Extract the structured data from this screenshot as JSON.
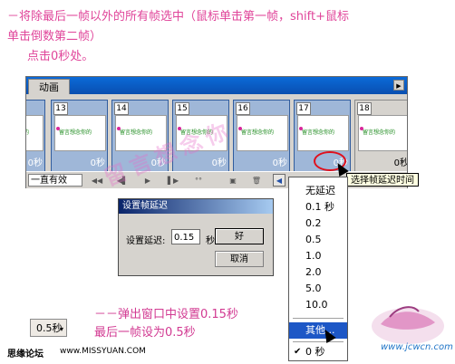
{
  "instructions": {
    "line1": "－将除最后一帧以外的所有帧选中（鼠标单击第一帧，shift+鼠标",
    "line2": "单击倒数第二帧）",
    "line3": "点击0秒处。",
    "bottom1": "－－弹出窗口中设置0.15秒",
    "bottom2": "最后一帧设为0.5秒"
  },
  "animation_panel": {
    "tab_label": "动画",
    "menu_button": "▶",
    "frames": [
      {
        "number": "",
        "delay": "0秒",
        "selected": true
      },
      {
        "number": "13",
        "delay": "0秒",
        "selected": true
      },
      {
        "number": "14",
        "delay": "0秒",
        "selected": true
      },
      {
        "number": "15",
        "delay": "0秒",
        "selected": true
      },
      {
        "number": "16",
        "delay": "0秒",
        "selected": true
      },
      {
        "number": "17",
        "delay": "0秒",
        "selected": true
      },
      {
        "number": "18",
        "delay": "0秒",
        "selected": false
      }
    ],
    "thumb_text": "留言想念你的",
    "loop_option": "一直有效",
    "scroll_left_icon": "◀",
    "tooltip": "选择帧延迟时间"
  },
  "delay_menu": {
    "items": [
      "无延迟",
      "0.1 秒",
      "0.2",
      "0.5",
      "1.0",
      "2.0",
      "5.0",
      "10.0"
    ],
    "other": "其他...",
    "checked": "0 秒",
    "check_mark": "✔"
  },
  "dialog": {
    "title": "设置帧延迟",
    "delay_label": "设置延迟:",
    "delay_value": "0.15",
    "unit": "秒",
    "ok": "好",
    "cancel": "取消"
  },
  "watermark": "留言想念你",
  "sample_select": "0.5秒",
  "footer": {
    "site_name": "思缘论坛",
    "url": "www.MISSYUAN.COM",
    "logo_text": "www.jcwcn.com"
  },
  "colors": {
    "instruction_pink": "#e0459a",
    "selected_frame": "#9fb7d8",
    "menu_highlight": "#1d57c6",
    "panel_gray": "#d6d3ce"
  }
}
